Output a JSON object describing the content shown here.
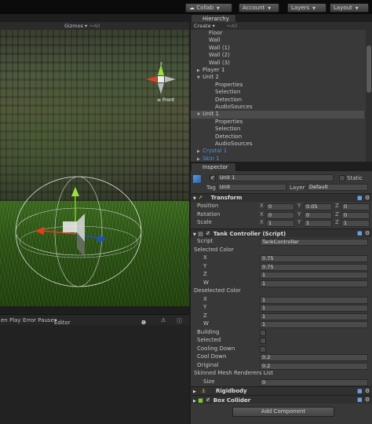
{
  "toolbar": {
    "collab": "Collab",
    "account": "Account",
    "layers": "Layers",
    "layout": "Layout"
  },
  "scene": {
    "gizmos": "Gizmos",
    "search_hint": "↔All",
    "view_label": "Front"
  },
  "status_bar": {
    "play_label": "en Play",
    "error_pause": "Error Pause",
    "editor": "Editor",
    "error_count": "0"
  },
  "hierarchy": {
    "tab": "Hierarchy",
    "create": "Create",
    "search_hint": "↔All",
    "items": [
      {
        "label": "Floor",
        "indent": 1,
        "arrow": "",
        "color": "normal"
      },
      {
        "label": "Wall",
        "indent": 1,
        "arrow": "",
        "color": "normal"
      },
      {
        "label": "Wall (1)",
        "indent": 1,
        "arrow": "",
        "color": "normal"
      },
      {
        "label": "Wall (2)",
        "indent": 1,
        "arrow": "",
        "color": "normal"
      },
      {
        "label": "Wall (3)",
        "indent": 1,
        "arrow": "",
        "color": "normal"
      },
      {
        "label": "Player 1",
        "indent": 0,
        "arrow": "▶",
        "color": "normal"
      },
      {
        "label": "Unit 2",
        "indent": 0,
        "arrow": "▼",
        "color": "normal"
      },
      {
        "label": "Properties",
        "indent": 2,
        "arrow": "",
        "color": "normal"
      },
      {
        "label": "Selection",
        "indent": 2,
        "arrow": "",
        "color": "normal"
      },
      {
        "label": "Detection",
        "indent": 2,
        "arrow": "",
        "color": "normal"
      },
      {
        "label": "AudioSources",
        "indent": 2,
        "arrow": "",
        "color": "normal"
      },
      {
        "label": "Unit 1",
        "indent": 0,
        "arrow": "▼",
        "color": "normal",
        "selected": true
      },
      {
        "label": "Properties",
        "indent": 2,
        "arrow": "",
        "color": "normal"
      },
      {
        "label": "Selection",
        "indent": 2,
        "arrow": "",
        "color": "normal"
      },
      {
        "label": "Detection",
        "indent": 2,
        "arrow": "",
        "color": "normal"
      },
      {
        "label": "AudioSources",
        "indent": 2,
        "arrow": "",
        "color": "normal"
      },
      {
        "label": "Crystal 1",
        "indent": 0,
        "arrow": "▶",
        "color": "blue"
      },
      {
        "label": "Skin 1",
        "indent": 0,
        "arrow": "▶",
        "color": "blue"
      }
    ]
  },
  "inspector": {
    "tab": "Inspector",
    "object_name": "Unit 1",
    "static": "Static",
    "tag_label": "Tag",
    "tag_value": "Unit",
    "layer_label": "Layer",
    "layer_value": "Default",
    "transform": {
      "title": "Transform",
      "position_label": "Position",
      "rotation_label": "Rotation",
      "scale_label": "Scale",
      "x": "X",
      "y": "Y",
      "z": "Z",
      "position": [
        "0",
        "0.05",
        "0"
      ],
      "rotation": [
        "0",
        "0",
        "0"
      ],
      "scale": [
        "1",
        "1",
        "1"
      ]
    },
    "tank": {
      "title": "Tank Controller (Script)",
      "script_label": "Script",
      "script_value": "TankController",
      "selected_color": "Selected Color",
      "selected_values": [
        "0.75",
        "0.75",
        "1",
        "1"
      ],
      "deselected_color": "Deselected Color",
      "deselected_values": [
        "1",
        "1",
        "1",
        "1"
      ],
      "axes": [
        "X",
        "Y",
        "Z",
        "W"
      ],
      "building": "Building",
      "selected": "Selected",
      "cooling_down": "Cooling Down",
      "cool_down_label": "Cool Down",
      "cool_down_value": "0.2",
      "original_label": "Original",
      "original_value": "0.2",
      "skinned": "Skinned Mesh Renderers List",
      "size_label": "Size",
      "size_value": "0"
    },
    "rigidbody": "Rigidbody",
    "box_collider": "Box Collider",
    "add_component": "Add Component"
  },
  "colors": {
    "accent_blue": "#4a87d8",
    "selected_row": "#4c4c4c",
    "panel": "#383838"
  }
}
